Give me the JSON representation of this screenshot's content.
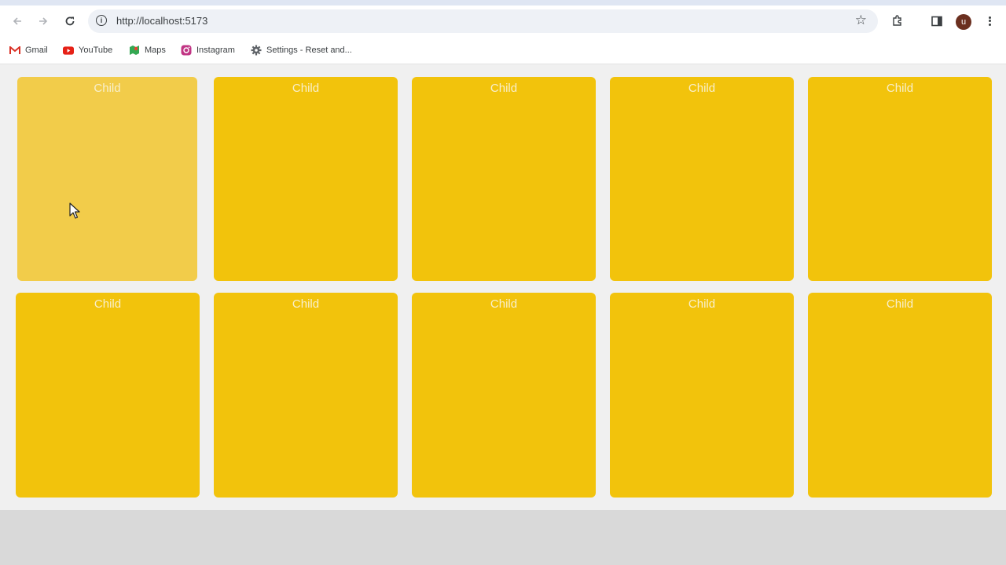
{
  "browser": {
    "url": "http://localhost:5173",
    "icons": {
      "back": "arrow-left-icon",
      "forward": "arrow-right-icon",
      "reload": "reload-icon",
      "site_info": "info-icon",
      "bookmark": "star-icon",
      "extensions": "puzzle-icon",
      "side_panel": "side-panel-icon",
      "menu": "kebab-menu-icon"
    },
    "avatar_initial": "u"
  },
  "bookmarks": [
    {
      "label": "Gmail",
      "icon": "gmail-icon"
    },
    {
      "label": "YouTube",
      "icon": "youtube-icon"
    },
    {
      "label": "Maps",
      "icon": "maps-icon"
    },
    {
      "label": "Instagram",
      "icon": "instagram-icon"
    },
    {
      "label": "Settings - Reset and...",
      "icon": "gear-icon"
    }
  ],
  "grid": {
    "colors": {
      "card": "#f2c30c",
      "card_hover": "#f2cc4a",
      "label": "#f8efcc",
      "background": "#f0f0f0"
    },
    "cards": [
      {
        "label": "Child",
        "hovered": true
      },
      {
        "label": "Child",
        "hovered": false
      },
      {
        "label": "Child",
        "hovered": false
      },
      {
        "label": "Child",
        "hovered": false
      },
      {
        "label": "Child",
        "hovered": false
      },
      {
        "label": "Child",
        "hovered": false
      },
      {
        "label": "Child",
        "hovered": false
      },
      {
        "label": "Child",
        "hovered": false
      },
      {
        "label": "Child",
        "hovered": false
      },
      {
        "label": "Child",
        "hovered": false
      }
    ]
  }
}
